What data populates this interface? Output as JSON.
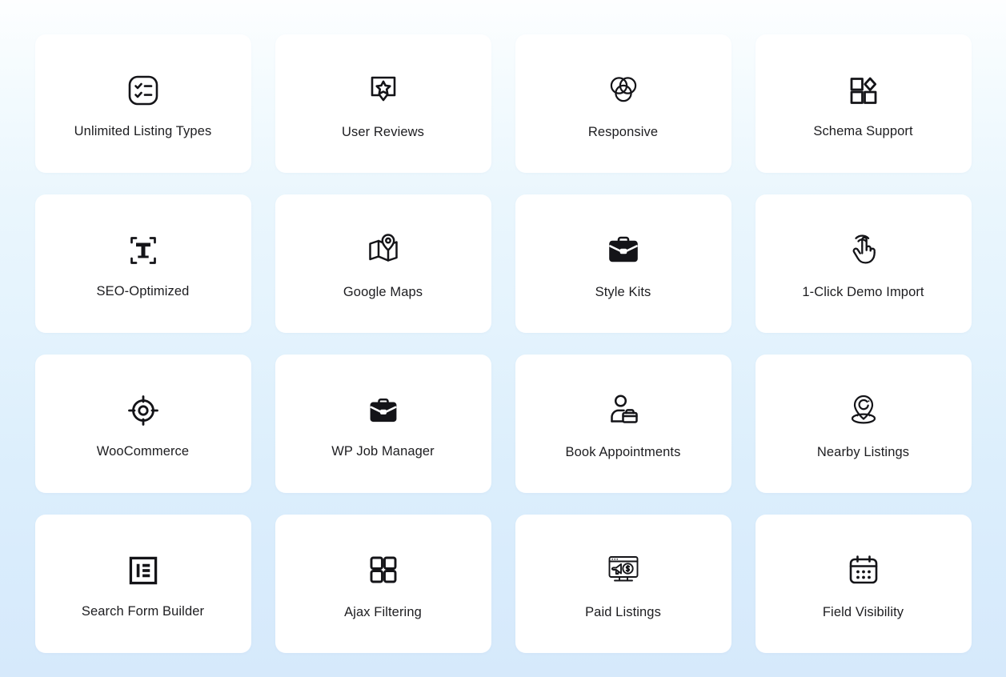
{
  "page": {
    "background_top_color": "#fdfeff",
    "background_bottom_color": "#d6e9fb",
    "card_color": "#ffffff",
    "text_color": "#1d1d20",
    "columns": 4,
    "rows": 4
  },
  "features": [
    {
      "label": "Unlimited Listing Types",
      "icon": "checklist-square-icon"
    },
    {
      "label": "User Reviews",
      "icon": "star-speech-bubble-icon"
    },
    {
      "label": "Responsive",
      "icon": "venn-three-circles-icon"
    },
    {
      "label": "Schema Support",
      "icon": "squares-diamond-grid-icon"
    },
    {
      "label": "SEO-Optimized",
      "icon": "text-frame-t-icon"
    },
    {
      "label": "Google Maps",
      "icon": "folded-map-pin-icon"
    },
    {
      "label": "Style Kits",
      "icon": "briefcase-icon"
    },
    {
      "label": "1-Click Demo Import",
      "icon": "tap-hand-icon"
    },
    {
      "label": "WooCommerce",
      "icon": "crosshair-target-icon"
    },
    {
      "label": "WP Job Manager",
      "icon": "briefcase-icon"
    },
    {
      "label": "Book Appointments",
      "icon": "person-briefcase-icon"
    },
    {
      "label": "Nearby Listings",
      "icon": "map-pin-radius-icon"
    },
    {
      "label": "Search Form Builder",
      "icon": "elementor-logo-icon"
    },
    {
      "label": "Ajax Filtering",
      "icon": "four-squares-grid-icon"
    },
    {
      "label": "Paid Listings",
      "icon": "monitor-megaphone-dollar-icon"
    },
    {
      "label": "Field Visibility",
      "icon": "calendar-dots-icon"
    }
  ]
}
